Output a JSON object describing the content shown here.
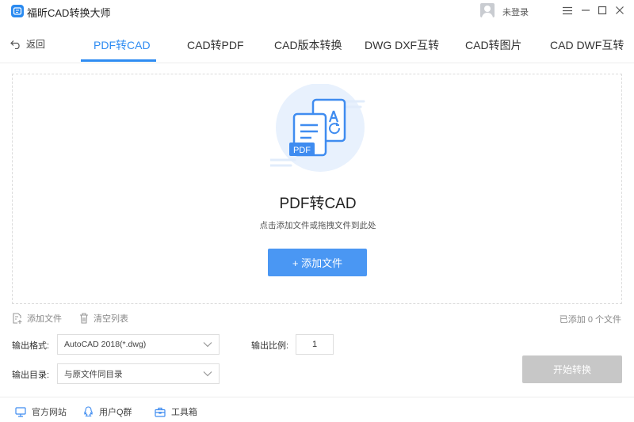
{
  "app": {
    "title": "福昕CAD转换大师",
    "user_status": "未登录"
  },
  "nav": {
    "back_label": "返回",
    "tabs": [
      {
        "label": "PDF转CAD",
        "active": true
      },
      {
        "label": "CAD转PDF",
        "active": false
      },
      {
        "label": "CAD版本转换",
        "active": false
      },
      {
        "label": "DWG DXF互转",
        "active": false
      },
      {
        "label": "CAD转图片",
        "active": false
      },
      {
        "label": "CAD DWF互转",
        "active": false
      }
    ]
  },
  "dropzone": {
    "title": "PDF转CAD",
    "hint": "点击添加文件或拖拽文件到此处",
    "add_button": "+ 添加文件",
    "illustration_label": "PDF"
  },
  "list_toolbar": {
    "add_file": "添加文件",
    "clear_list": "清空列表",
    "count_text": "已添加 0 个文件"
  },
  "settings": {
    "format_label": "输出格式:",
    "format_value": "AutoCAD 2018(*.dwg)",
    "dir_label": "输出目录:",
    "dir_value": "与原文件同目录",
    "scale_label": "输出比例:",
    "scale_value": "1",
    "start_button": "开始转换"
  },
  "footer": {
    "links": [
      "官方网站",
      "用户Q群",
      "工具箱"
    ]
  },
  "colors": {
    "accent": "#2f8cf2",
    "button": "#4a97f3",
    "disabled": "#c7c7c7"
  }
}
